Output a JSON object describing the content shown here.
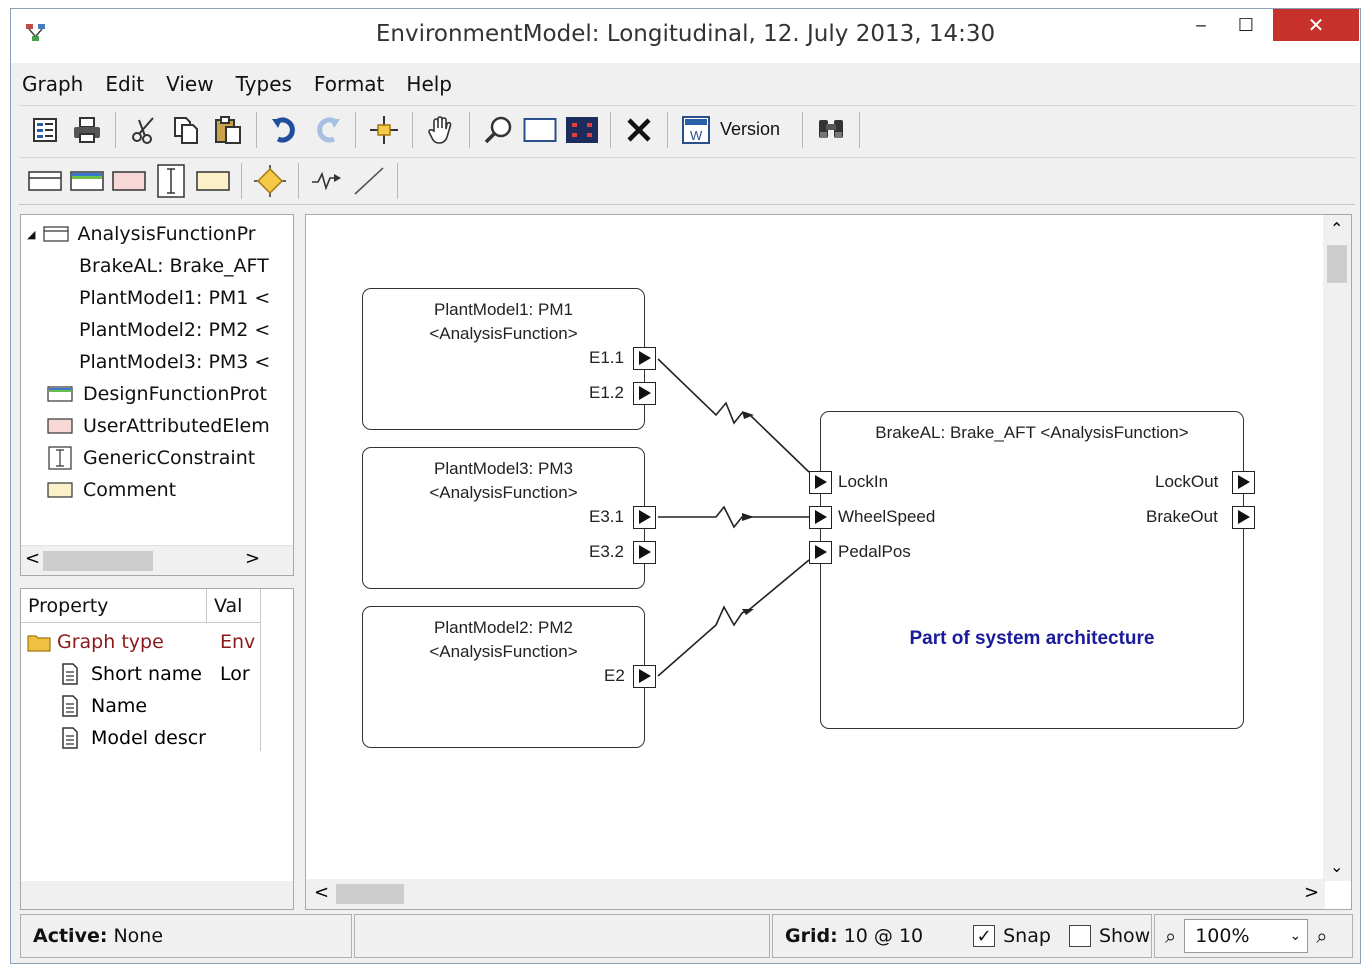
{
  "window": {
    "title": "EnvironmentModel: Longitudinal, 12. July 2013, 14:30",
    "minimize": "‒",
    "maximize": "☐",
    "close": "✕"
  },
  "menu": [
    "Graph",
    "Edit",
    "View",
    "Types",
    "Format",
    "Help"
  ],
  "toolbar": {
    "version_label": "Version"
  },
  "tree": {
    "items": [
      {
        "label": "AnalysisFunctionPr",
        "icon": "analysis-function-icon"
      },
      {
        "label": "BrakeAL: Brake_AFT"
      },
      {
        "label": "PlantModel1: PM1 <"
      },
      {
        "label": "PlantModel2: PM2 <"
      },
      {
        "label": "PlantModel3: PM3 <"
      },
      {
        "label": "DesignFunctionProt",
        "icon": "design-function-icon"
      },
      {
        "label": "UserAttributedElem",
        "icon": "user-attributed-icon"
      },
      {
        "label": "GenericConstraint",
        "icon": "generic-constraint-icon"
      },
      {
        "label": "Comment",
        "icon": "comment-icon"
      }
    ],
    "scroll_left": "<",
    "scroll_right": ">"
  },
  "properties": {
    "col_property": "Property",
    "col_value": "Val",
    "rows": [
      {
        "name": "Graph type",
        "value": "Env"
      },
      {
        "name": "Short name",
        "value": "Lor"
      },
      {
        "name": "Name",
        "value": ""
      },
      {
        "name": "Model descr",
        "value": ""
      }
    ]
  },
  "diagram": {
    "blocks": [
      {
        "title1": "PlantModel1: PM1",
        "title2": "<AnalysisFunction>",
        "ports": [
          "E1.1",
          "E1.2"
        ]
      },
      {
        "title1": "PlantModel3: PM3",
        "title2": "<AnalysisFunction>",
        "ports": [
          "E3.1",
          "E3.2"
        ]
      },
      {
        "title1": "PlantModel2: PM2",
        "title2": "<AnalysisFunction>",
        "ports": [
          "E2"
        ]
      }
    ],
    "brake": {
      "title": "BrakeAL: Brake_AFT <AnalysisFunction>",
      "in_ports": [
        "LockIn",
        "WheelSpeed",
        "PedalPos"
      ],
      "out_ports": [
        "LockOut",
        "BrakeOut"
      ],
      "note": "Part of system architecture",
      "note_color": "#1a1a9c"
    }
  },
  "status": {
    "active_label": "Active:",
    "active_value": "None",
    "grid_label": "Grid:",
    "grid_value": "10 @ 10",
    "snap_label": "Snap",
    "snap_checked": true,
    "show_label": "Show",
    "show_checked": false,
    "zoom": "100%"
  },
  "colors": {
    "close_button": "#c7312b",
    "graph_type_text": "#8b1a1a",
    "link_blue": "#1a1a9c"
  }
}
